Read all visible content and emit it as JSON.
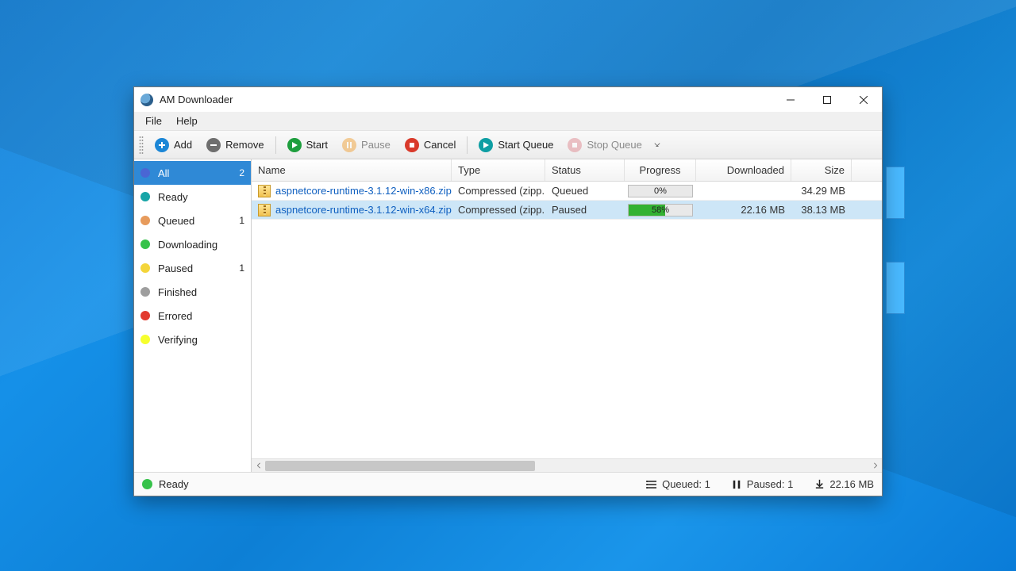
{
  "window": {
    "title": "AM Downloader"
  },
  "menu": {
    "file": "File",
    "help": "Help"
  },
  "toolbar": {
    "add": "Add",
    "remove": "Remove",
    "start": "Start",
    "pause": "Pause",
    "cancel": "Cancel",
    "start_queue": "Start Queue",
    "stop_queue": "Stop Queue"
  },
  "sidebar": {
    "items": [
      {
        "label": "All",
        "count": "2",
        "color": "#4a66d4",
        "selected": true
      },
      {
        "label": "Ready",
        "count": "",
        "color": "#18a5a7",
        "selected": false
      },
      {
        "label": "Queued",
        "count": "1",
        "color": "#e79b5c",
        "selected": false
      },
      {
        "label": "Downloading",
        "count": "",
        "color": "#36c24a",
        "selected": false
      },
      {
        "label": "Paused",
        "count": "1",
        "color": "#f4d53a",
        "selected": false
      },
      {
        "label": "Finished",
        "count": "",
        "color": "#9e9e9e",
        "selected": false
      },
      {
        "label": "Errored",
        "count": "",
        "color": "#e23b2f",
        "selected": false
      },
      {
        "label": "Verifying",
        "count": "",
        "color": "#f6ff2e",
        "selected": false
      }
    ]
  },
  "columns": {
    "name": "Name",
    "type": "Type",
    "status": "Status",
    "progress": "Progress",
    "downloaded": "Downloaded",
    "size": "Size"
  },
  "rows": [
    {
      "name": "aspnetcore-runtime-3.1.12-win-x86.zip",
      "type": "Compressed (zipp...",
      "status": "Queued",
      "progress": 0,
      "progress_label": "0%",
      "downloaded": "",
      "size": "34.29 MB",
      "selected": false
    },
    {
      "name": "aspnetcore-runtime-3.1.12-win-x64.zip",
      "type": "Compressed (zipp...",
      "status": "Paused",
      "progress": 58,
      "progress_label": "58%",
      "downloaded": "22.16 MB",
      "size": "38.13 MB",
      "selected": true
    }
  ],
  "status": {
    "state": "Ready",
    "queued": "Queued: 1",
    "paused": "Paused: 1",
    "downloaded": "22.16 MB"
  }
}
